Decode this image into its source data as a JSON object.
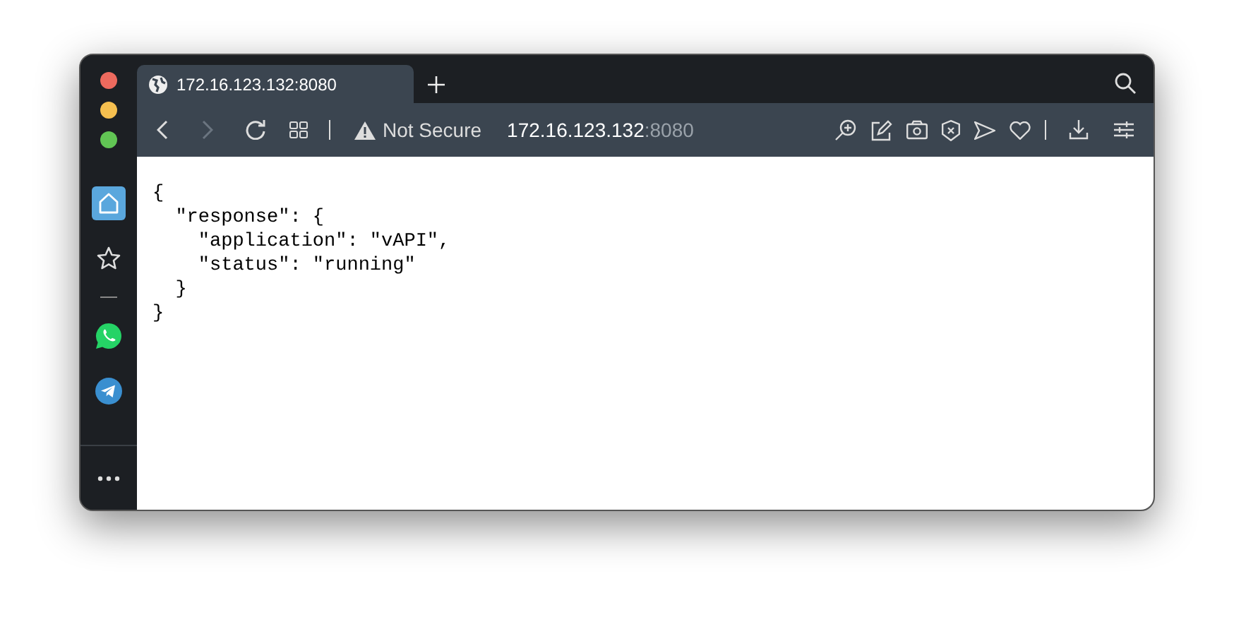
{
  "tab": {
    "title": "172.16.123.132:8080",
    "selected": true
  },
  "address_bar": {
    "security": "Not Secure",
    "host": "172.16.123.132",
    "port": ":8080"
  },
  "sidebar": {
    "items": [
      {
        "kind": "home",
        "selected": true
      },
      {
        "kind": "star",
        "selected": false
      },
      {
        "kind": "whatsapp",
        "selected": false
      },
      {
        "kind": "telegram",
        "selected": false
      }
    ]
  },
  "page": {
    "lines": [
      "{",
      "  \"response\": {",
      "    \"application\": \"vAPI\",",
      "    \"status\": \"running\"",
      "  }",
      "}"
    ]
  }
}
